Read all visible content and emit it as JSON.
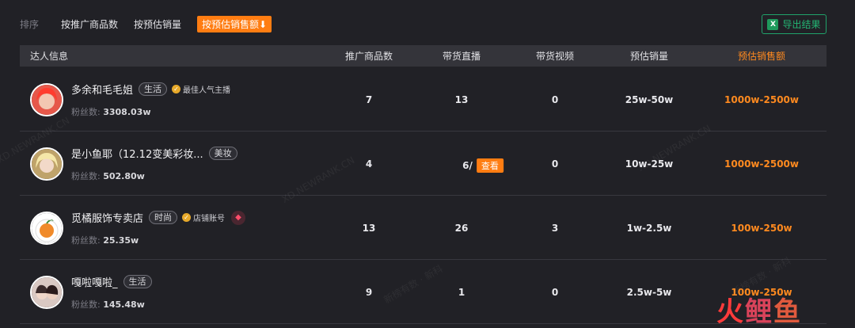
{
  "sort": {
    "label": "排序",
    "options": [
      "按推广商品数",
      "按预估销量",
      "按预估销售额⬇"
    ],
    "active_index": 2
  },
  "export_label": "导出结果",
  "columns": [
    "达人信息",
    "推广商品数",
    "带货直播",
    "带货视频",
    "预估销量",
    "预估销售额"
  ],
  "fans_label": "粉丝数:",
  "view_label": "查看",
  "rows": [
    {
      "name": "多余和毛毛姐",
      "tag": "生活",
      "badge": "最佳人气主播",
      "fans": "3308.03w",
      "products": "7",
      "live": "13",
      "video": "0",
      "sales": "25w-50w",
      "revenue": "1000w-2500w"
    },
    {
      "name": "是小鱼耶（12.12变美彩妆...",
      "tag": "美妆",
      "badge": "",
      "fans": "502.80w",
      "products": "4",
      "live": "6/",
      "video": "0",
      "sales": "10w-25w",
      "revenue": "1000w-2500w"
    },
    {
      "name": "觅橘服饰专卖店",
      "tag": "时尚",
      "badge": "店铺账号",
      "fans": "25.35w",
      "products": "13",
      "live": "26",
      "video": "3",
      "sales": "1w-2.5w",
      "revenue": "100w-250w"
    },
    {
      "name": "嘎啦嘎啦_",
      "tag": "生活",
      "badge": "",
      "fans": "145.48w",
      "products": "9",
      "live": "1",
      "video": "0",
      "sales": "2.5w-5w",
      "revenue": "100w-250w"
    }
  ],
  "watermarks": [
    "XD.NEWRANK.CN",
    "新榜有数 · 新科"
  ],
  "logo": [
    "火",
    "鲤",
    "鱼"
  ],
  "colors": {
    "accent": "#ff7d12",
    "export": "#23b573",
    "background": "#212126"
  }
}
